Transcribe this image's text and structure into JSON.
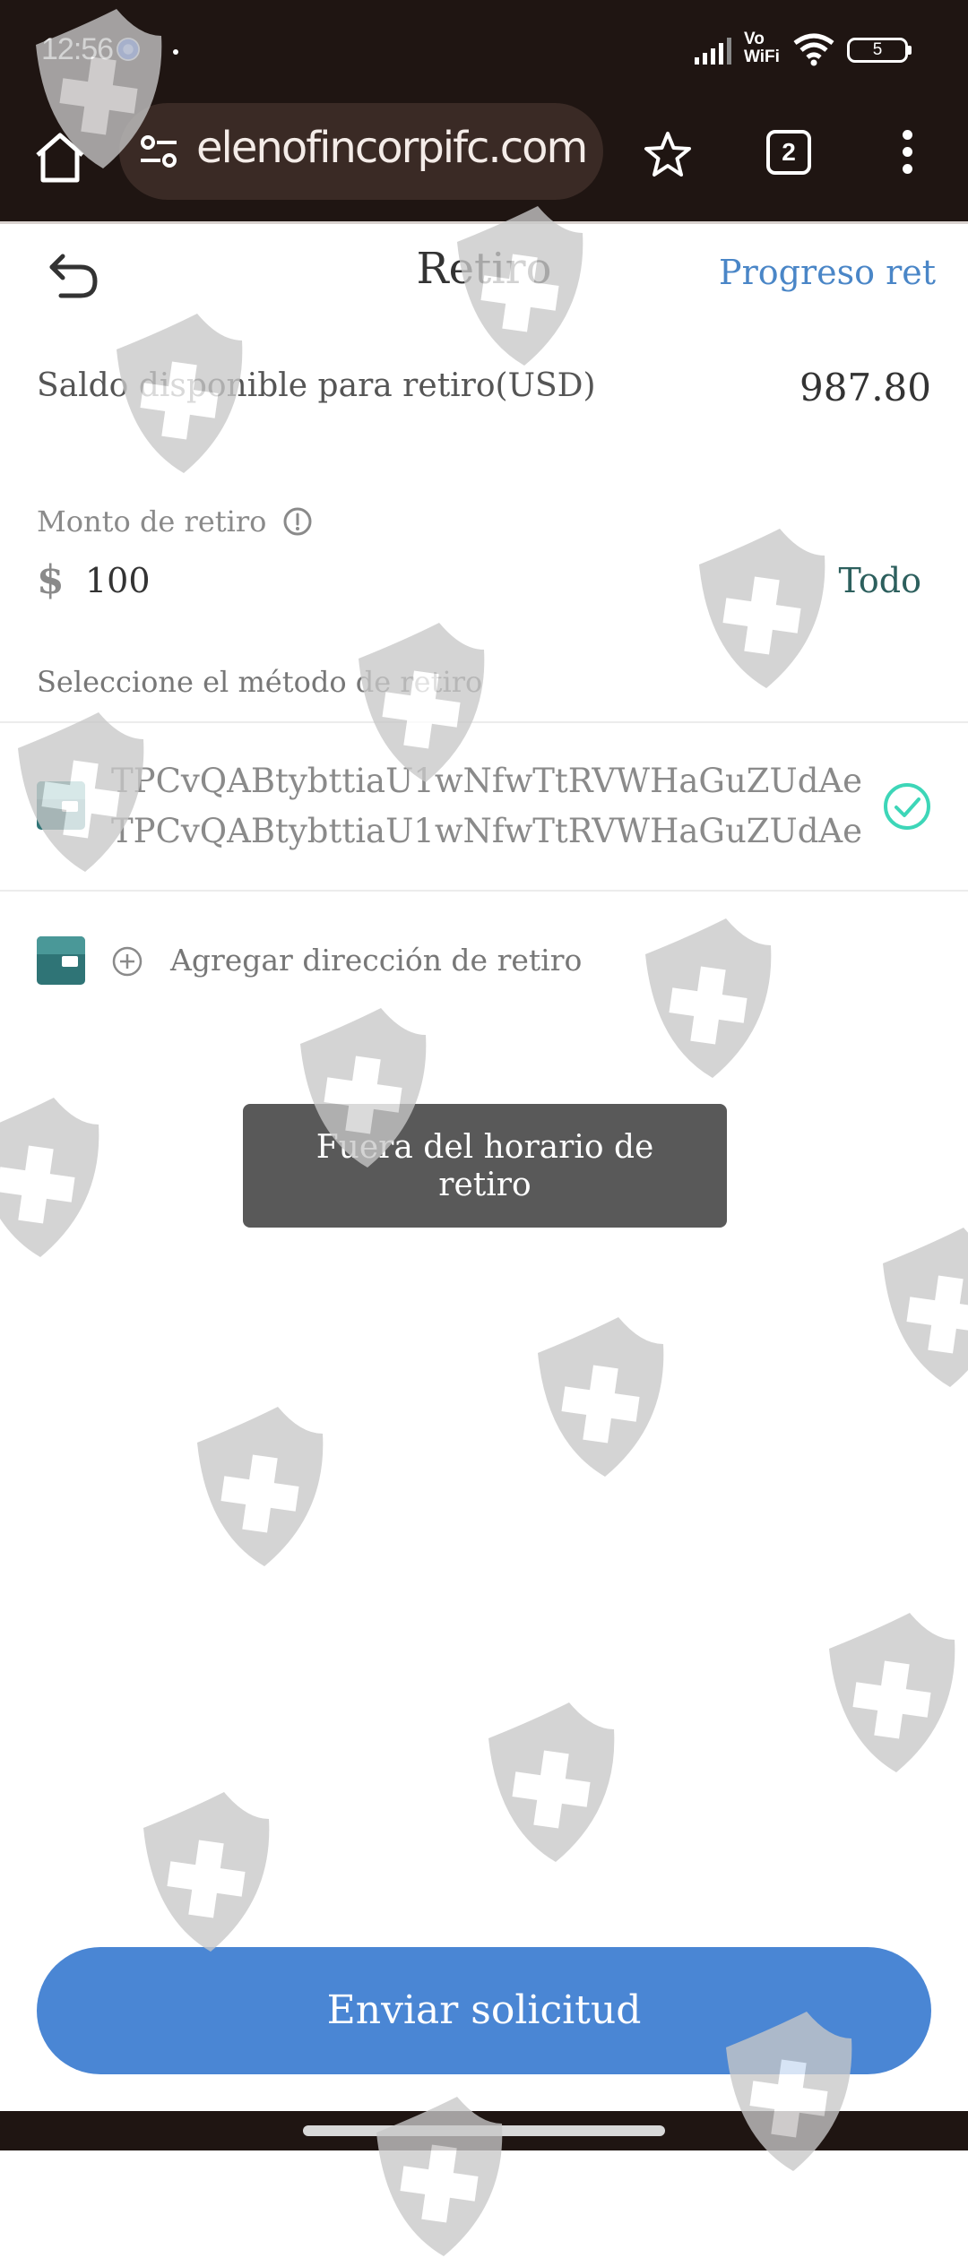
{
  "status_bar": {
    "time": "12:56",
    "network": "Vo\nWiFi",
    "battery": "5"
  },
  "browser": {
    "url": "elenofincorpifc.com",
    "tab_count": "2"
  },
  "header": {
    "title": "Retiro",
    "progress_link": "Progreso ret"
  },
  "balance": {
    "label": "Saldo disponible para retiro(USD)",
    "value": "987.80"
  },
  "amount": {
    "label": "Monto de retiro",
    "currency": "$",
    "value": "100",
    "all_button": "Todo"
  },
  "method": {
    "label": "Seleccione el método de retiro",
    "address_line1": "TPCvQABtybttiaU1wNfwTtRVWHaGuZUdAe",
    "address_line2": "TPCvQABtybttiaU1wNfwTtRVWHaGuZUdAe",
    "add_address": "Agregar dirección de retiro"
  },
  "toast": "Fuera del horario de retiro",
  "submit_button": "Enviar solicitud",
  "colors": {
    "accent": "#4a86d4",
    "link": "#4a86c7",
    "wallet": "#2f7476",
    "check": "#3dd6b8"
  }
}
